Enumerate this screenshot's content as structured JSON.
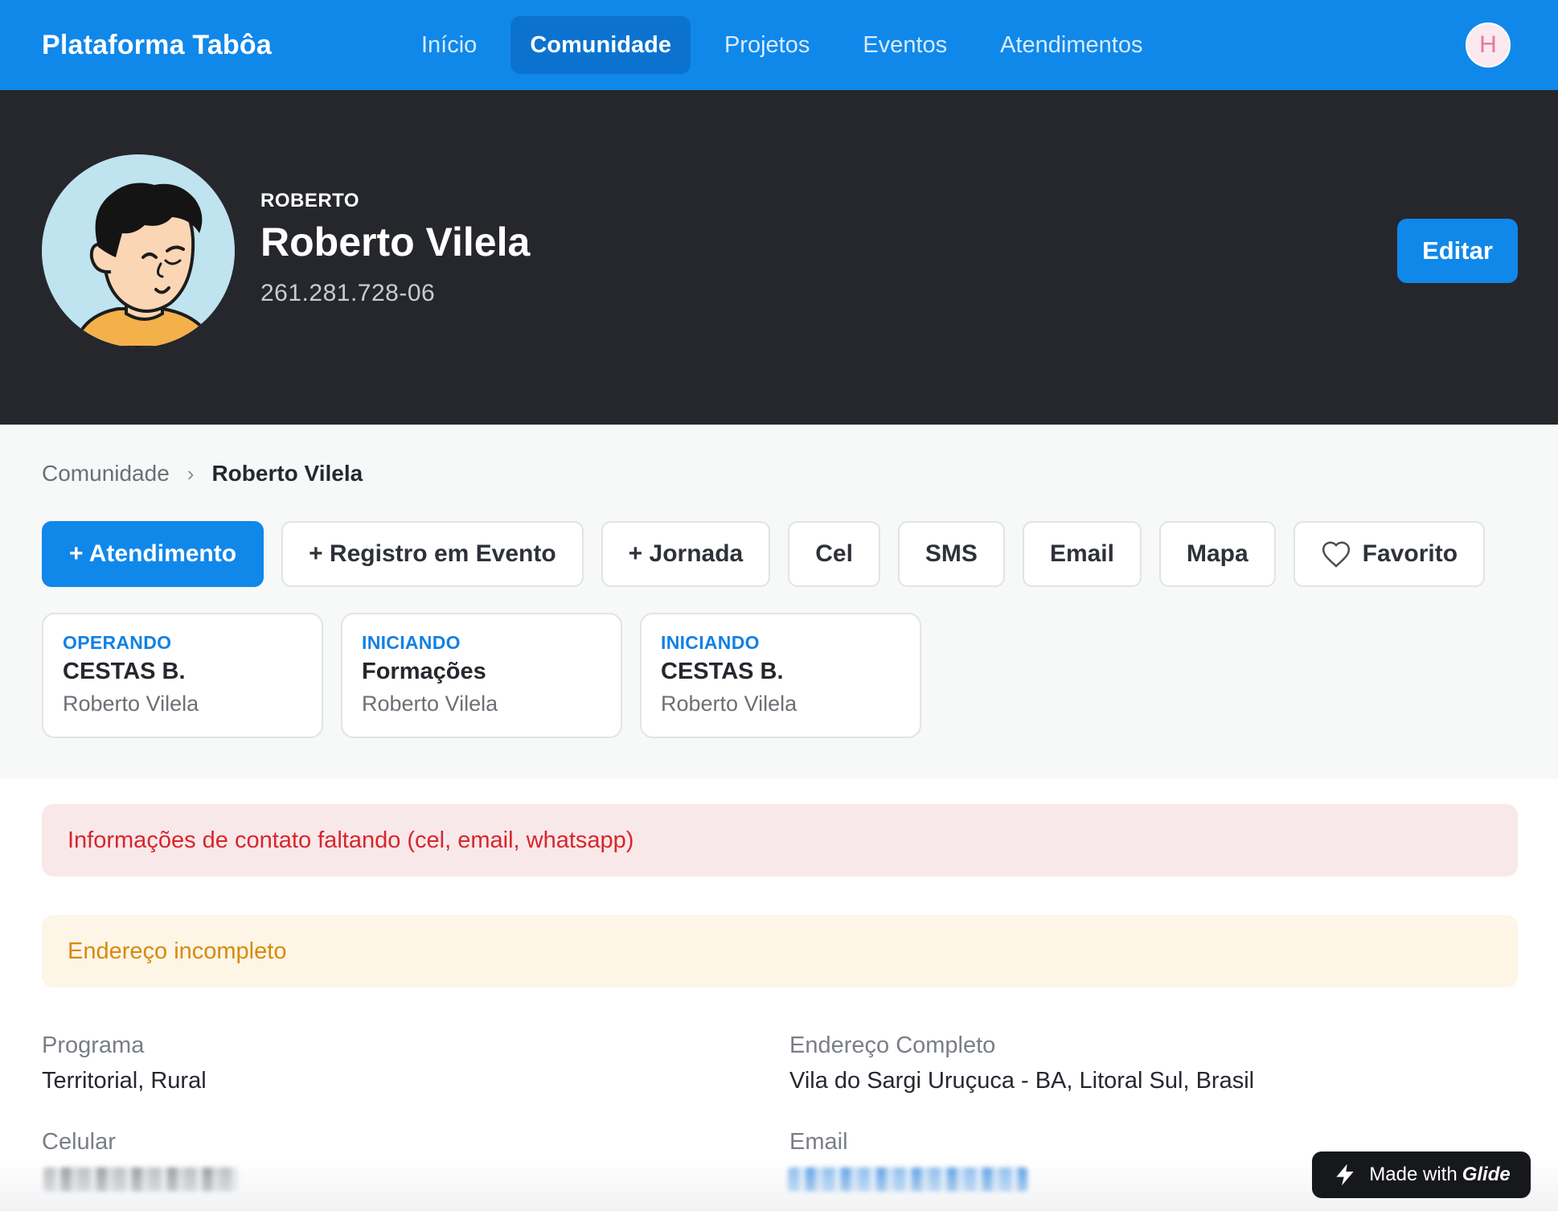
{
  "nav": {
    "brand": "Plataforma Tabôa",
    "links": [
      {
        "label": "Início"
      },
      {
        "label": "Comunidade",
        "active": true
      },
      {
        "label": "Projetos"
      },
      {
        "label": "Eventos"
      },
      {
        "label": "Atendimentos"
      }
    ],
    "user_initial": "H"
  },
  "profile": {
    "kicker": "ROBERTO",
    "name": "Roberto Vilela",
    "cpf": "261.281.728-06",
    "edit_label": "Editar"
  },
  "breadcrumb": {
    "parent": "Comunidade",
    "separator": "›",
    "current": "Roberto Vilela"
  },
  "actions": [
    {
      "label": "+ Atendimento",
      "primary": true
    },
    {
      "label": "+ Registro em Evento"
    },
    {
      "label": "+ Jornada"
    },
    {
      "label": "Cel"
    },
    {
      "label": "SMS"
    },
    {
      "label": "Email"
    },
    {
      "label": "Mapa"
    },
    {
      "label": "Favorito",
      "icon": "heart-icon"
    }
  ],
  "journeys": [
    {
      "status": "OPERANDO",
      "title": "CESTAS B.",
      "person": "Roberto Vilela"
    },
    {
      "status": "INICIANDO",
      "title": "Formações",
      "person": "Roberto Vilela"
    },
    {
      "status": "INICIANDO",
      "title": "CESTAS B.",
      "person": "Roberto Vilela"
    }
  ],
  "alerts": {
    "contact_missing": "Informações de contato faltando (cel, email, whatsapp)",
    "address_incomplete": "Endereço incompleto"
  },
  "details": {
    "programa": {
      "label": "Programa",
      "value": "Territorial, Rural"
    },
    "endereco": {
      "label": "Endereço Completo",
      "value": "Vila do Sargi Uruçuca - BA, Litoral Sul, Brasil"
    },
    "celular": {
      "label": "Celular"
    },
    "email": {
      "label": "Email"
    }
  },
  "badge": {
    "prefix": "Made with",
    "brand": "Glide"
  },
  "colors": {
    "primary": "#1088ea",
    "nav_active": "#0b73cf",
    "hero_bg": "#25272d",
    "error_bg": "#f9e8ea",
    "error_text": "#d7262b",
    "warn_bg": "#fdf5e6",
    "warn_text": "#d88a0c",
    "status_text": "#1281e3"
  }
}
